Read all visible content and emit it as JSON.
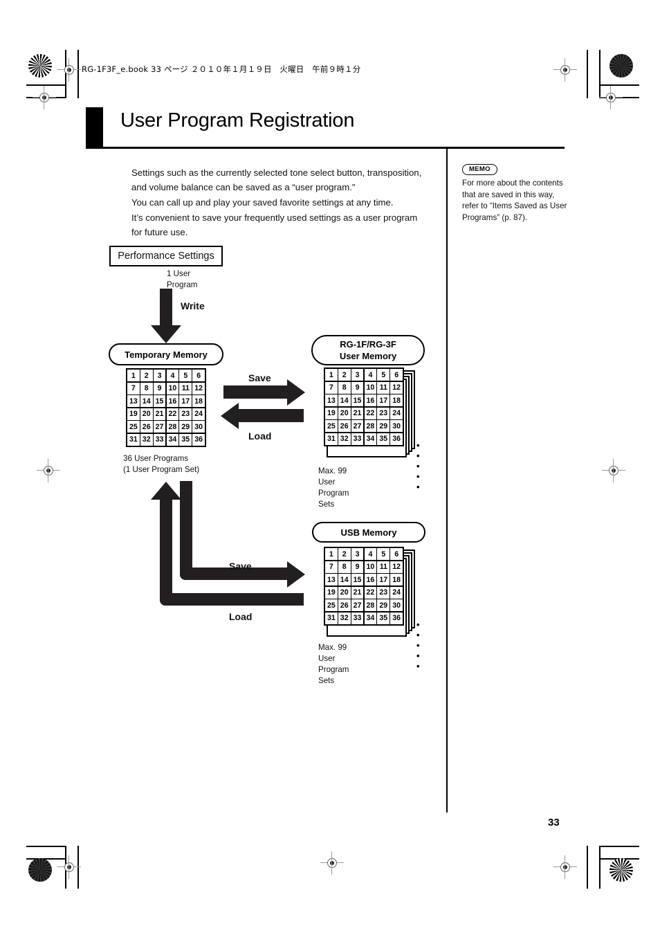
{
  "print_header": "RG-1F3F_e.book 33 ページ ２０１０年１月１９日　火曜日　午前９時１分",
  "title": "User Program Registration",
  "body_paragraphs": [
    "Settings such as the currently selected tone select button, transposition, and volume balance can be saved as a “user program.”",
    "You can call up and play your saved favorite settings at any time.",
    "It’s convenient to save your frequently used settings as a user program for future use."
  ],
  "memo": {
    "badge": "MEMO",
    "text": "For more about the contents that are saved in this way, refer to  “Items Saved as User Programs” (p. 87)."
  },
  "diagram": {
    "performance_settings": {
      "label": "Performance Settings",
      "caption": "1 User Program"
    },
    "write_label": "Write",
    "temporary_memory": {
      "label": "Temporary Memory",
      "caption": "36 User Programs\n(1 User Program Set)"
    },
    "user_memory": {
      "label_line1": "RG-1F/RG-3F",
      "label_line2": "User Memory",
      "caption": "Max. 99 User Program Sets"
    },
    "usb_memory": {
      "label": "USB Memory",
      "caption": "Max. 99 User Program Sets"
    },
    "save_label_top": "Save",
    "load_label_top": "Load",
    "save_label_bottom": "Save",
    "load_label_bottom": "Load",
    "stack_dots": "• • • • •",
    "grid_numbers": [
      "1",
      "2",
      "3",
      "4",
      "5",
      "6",
      "7",
      "8",
      "9",
      "10",
      "11",
      "12",
      "13",
      "14",
      "15",
      "16",
      "17",
      "18",
      "19",
      "20",
      "21",
      "22",
      "23",
      "24",
      "25",
      "26",
      "27",
      "28",
      "29",
      "30",
      "31",
      "32",
      "33",
      "34",
      "35",
      "36"
    ]
  },
  "page_number": "33",
  "colors": {
    "ink": "#000000",
    "arrow": "#231f20",
    "rule": "#000000"
  }
}
